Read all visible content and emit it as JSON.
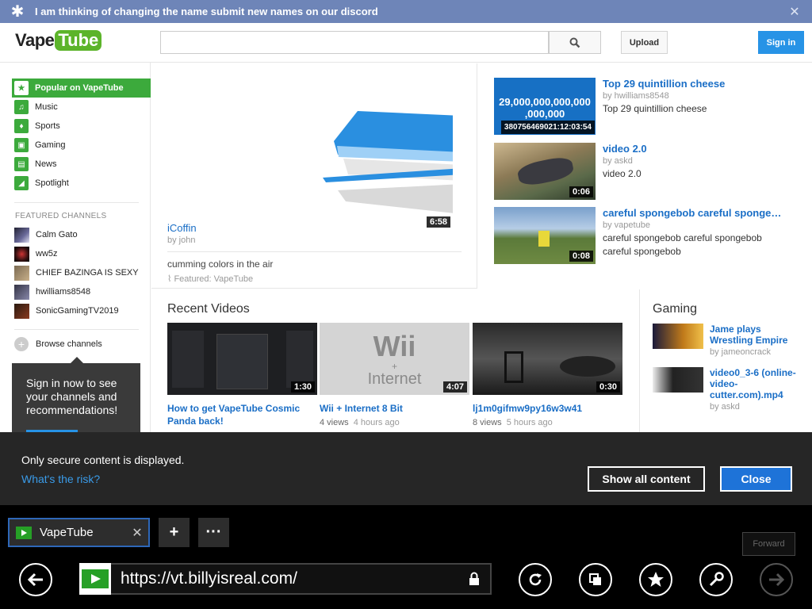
{
  "banner": {
    "text": "I am thinking of changing the name submit new names on our discord",
    "close_label": "✕"
  },
  "header": {
    "logo_part1": "Vape",
    "logo_part2": "Tube",
    "search_placeholder": "",
    "upload_label": "Upload",
    "signin_label": "Sign in"
  },
  "sidebar": {
    "nav": [
      {
        "label": "Popular on VapeTube",
        "icon": "star-icon"
      },
      {
        "label": "Music",
        "icon": "headphones-icon"
      },
      {
        "label": "Sports",
        "icon": "trophy-icon"
      },
      {
        "label": "Gaming",
        "icon": "gamepad-icon"
      },
      {
        "label": "News",
        "icon": "newspaper-icon"
      },
      {
        "label": "Spotlight",
        "icon": "spotlight-icon"
      }
    ],
    "featured_heading": "FEATURED CHANNELS",
    "channels": [
      "Calm Gato",
      "ww5z",
      "CHIEF BAZINGA IS SEXY",
      "hwilliams8548",
      "SonicGamingTV2019"
    ],
    "browse_label": "Browse channels",
    "signin_prompt": "Sign in now to see your channels and recommendations!"
  },
  "featured": {
    "duration": "6:58",
    "title": "iCoffin",
    "by": "by john",
    "description": "cumming colors in the air",
    "featured_by": "Featured: VapeTube"
  },
  "right_videos": [
    {
      "title": "Top 29 quintillion cheese",
      "by": "by hwilliams8548",
      "desc": "Top 29 quintillion cheese",
      "thumb_text1": "29,000,000,000,000",
      "thumb_text2": ",000,000",
      "duration": "380756469021:12:03:54"
    },
    {
      "title": "video 2.0",
      "by": "by askd",
      "desc": "video 2.0",
      "duration": "0:06"
    },
    {
      "title": "careful spongebob careful sponge…",
      "by": "by vapetube",
      "desc": "careful spongebob careful spongebob careful spongebob",
      "duration": "0:08"
    }
  ],
  "recent": {
    "heading": "Recent Videos",
    "items": [
      {
        "title": "How to get VapeTube Cosmic Panda back!",
        "views": "",
        "ago": "",
        "duration": "1:30"
      },
      {
        "title": "Wii + Internet 8 Bit",
        "views": "4 views",
        "ago": "4 hours ago",
        "duration": "4:07",
        "thumb_big": "Wii",
        "thumb_plus": "+",
        "thumb_small": "Internet"
      },
      {
        "title": "lj1m0gifmw9py16w3w41",
        "views": "8 views",
        "ago": "5 hours ago",
        "duration": "0:30"
      }
    ]
  },
  "gaming": {
    "heading": "Gaming",
    "items": [
      {
        "title": "Jame plays Wrestling Empire",
        "by": "by jameoncrack"
      },
      {
        "title": "video0_3-6 (online-video-cutter.com).mp4",
        "by": "by askd"
      }
    ]
  },
  "notice": {
    "message": "Only secure content is displayed.",
    "risk_link": "What's the risk?",
    "show_all": "Show all content",
    "close": "Close"
  },
  "browser": {
    "tab_title": "VapeTube",
    "tab_close": "✕",
    "new_tab": "+",
    "more": "···",
    "forward_tip": "Forward",
    "url": "https://vt.billyisreal.com/"
  }
}
